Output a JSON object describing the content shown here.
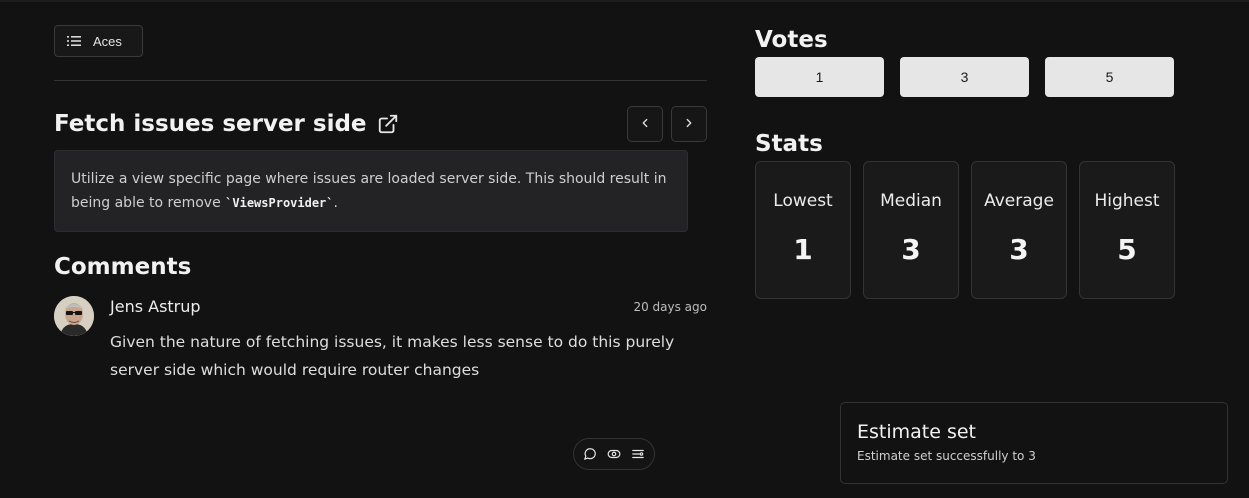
{
  "room_button": {
    "label": "Aces"
  },
  "issue": {
    "title": "Fetch issues server side",
    "description_before": "Utilize a view specific page where issues are loaded server side. This should result in being able to remove ",
    "description_code": "`ViewsProvider`",
    "description_after": "."
  },
  "comments": {
    "title": "Comments",
    "items": [
      {
        "author": "Jens Astrup",
        "time": "20 days ago",
        "body": "Given the nature of fetching issues, it makes less sense to do this purely server side which would require router changes"
      }
    ]
  },
  "votes": {
    "title": "Votes",
    "options": [
      "1",
      "3",
      "5"
    ]
  },
  "stats": {
    "title": "Stats",
    "items": [
      {
        "label": "Lowest",
        "value": "1"
      },
      {
        "label": "Median",
        "value": "3"
      },
      {
        "label": "Average",
        "value": "3"
      },
      {
        "label": "Highest",
        "value": "5"
      }
    ]
  },
  "toast": {
    "title": "Estimate set",
    "message": "Estimate set successfully to 3"
  },
  "icons": {
    "room": "list-icon",
    "external": "external-link-icon",
    "prev": "chevron-left-icon",
    "next": "chevron-right-icon",
    "toolbar": [
      "comment-icon",
      "eye-icon",
      "list-settings-icon"
    ]
  }
}
